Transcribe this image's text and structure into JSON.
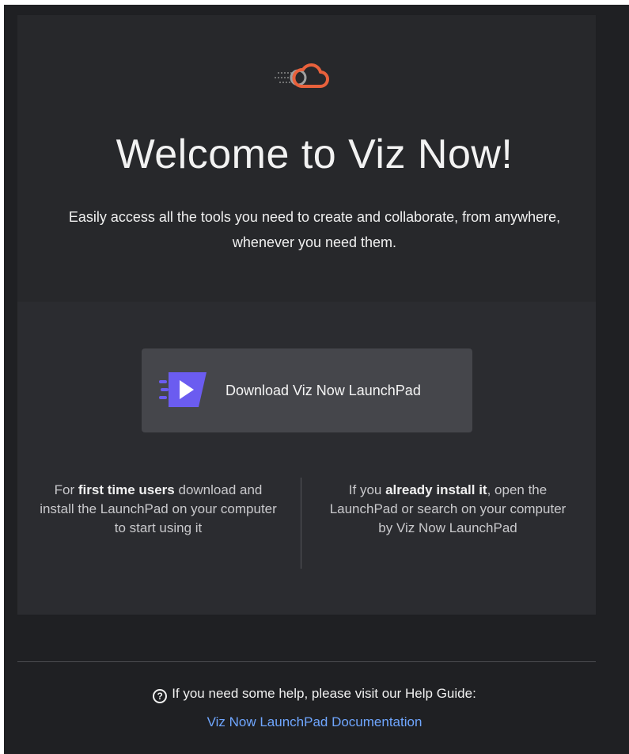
{
  "header": {
    "title": "Welcome to Viz Now!",
    "subtitle": "Easily access all the tools you need to create and collaborate, from anywhere, whenever you need them.",
    "logo_icon": "viz-now-cloud-icon"
  },
  "download": {
    "label": "Download Viz Now LaunchPad",
    "icon": "launchpad-icon"
  },
  "info": {
    "left": {
      "prefix": "For ",
      "bold": "first time users",
      "suffix": " download and install the LaunchPad on your computer to start using it"
    },
    "right": {
      "prefix": "If you ",
      "bold": "already install it",
      "suffix": ", open the LaunchPad or search on your computer by Viz Now LaunchPad"
    }
  },
  "help": {
    "icon": "question-circle-icon",
    "text": "If you need some help, please visit our Help Guide:",
    "link_label": "Viz Now LaunchPad Documentation"
  },
  "colors": {
    "background": "#1f2023",
    "card_top": "#27282b",
    "card_bottom": "#2b2c30",
    "button": "#45464b",
    "accent_orange": "#e8613c",
    "accent_purple": "#6b5cf0",
    "link": "#6fa6ff"
  }
}
